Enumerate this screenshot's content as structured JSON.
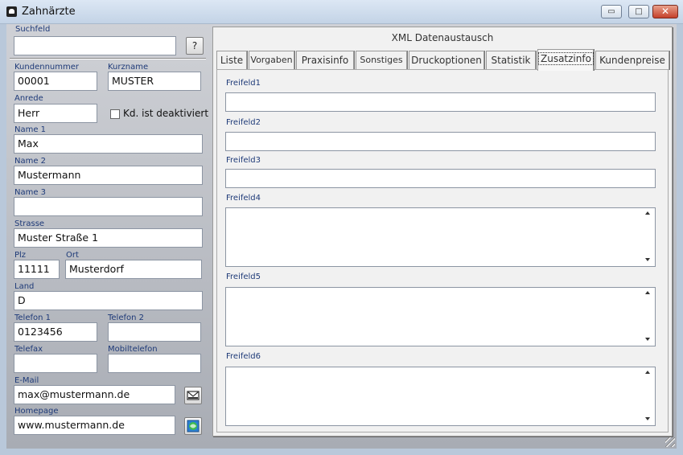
{
  "window": {
    "title": "Zahnärzte",
    "minimize_glyph": "▭",
    "maximize_glyph": "□",
    "close_glyph": "✕"
  },
  "search": {
    "label": "Suchfeld",
    "value": "",
    "button_label": "?"
  },
  "customer": {
    "kundennummer": {
      "label": "Kundennummer",
      "value": "00001"
    },
    "kurzname": {
      "label": "Kurzname",
      "value": "MUSTER"
    },
    "anrede": {
      "label": "Anrede",
      "value": "Herr"
    },
    "deaktiviert": {
      "label": "Kd. ist deaktiviert",
      "checked": false
    },
    "name1": {
      "label": "Name 1",
      "value": "Max"
    },
    "name2": {
      "label": "Name 2",
      "value": "Mustermann"
    },
    "name3": {
      "label": "Name 3",
      "value": ""
    },
    "strasse": {
      "label": "Strasse",
      "value": "Muster Straße 1"
    },
    "plz": {
      "label": "Plz",
      "value": "11111"
    },
    "ort": {
      "label": "Ort",
      "value": "Musterdorf"
    },
    "land": {
      "label": "Land",
      "value": "D"
    },
    "telefon1": {
      "label": "Telefon 1",
      "value": "0123456"
    },
    "telefon2": {
      "label": "Telefon 2",
      "value": ""
    },
    "telefax": {
      "label": "Telefax",
      "value": ""
    },
    "mobiltelefon": {
      "label": "Mobiltelefon",
      "value": ""
    },
    "email": {
      "label": "E-Mail",
      "value": "max@mustermann.de",
      "button_icon": "mail-icon"
    },
    "homepage": {
      "label": "Homepage",
      "value": "www.mustermann.de",
      "button_icon": "globe-icon"
    }
  },
  "panel": {
    "header": "XML Datenaustausch",
    "tabs": [
      {
        "label": "Liste"
      },
      {
        "label": "Vorgaben"
      },
      {
        "label": "Praxisinfo"
      },
      {
        "label": "Sonstiges"
      },
      {
        "label": "Druckoptionen"
      },
      {
        "label": "Statistik"
      },
      {
        "label": "Zusatzinfo"
      },
      {
        "label": "Kundenpreise"
      }
    ],
    "active_tab": "Zusatzinfo",
    "fields": [
      {
        "label": "Freifeld1",
        "value": ""
      },
      {
        "label": "Freifeld2",
        "value": ""
      },
      {
        "label": "Freifeld3",
        "value": ""
      },
      {
        "label": "Freifeld4",
        "value": ""
      },
      {
        "label": "Freifeld5",
        "value": ""
      },
      {
        "label": "Freifeld6",
        "value": ""
      }
    ]
  },
  "colors": {
    "label_blue": "#1e3a78",
    "titlebar": "#c3d3e6",
    "close_red": "#c5402a"
  }
}
